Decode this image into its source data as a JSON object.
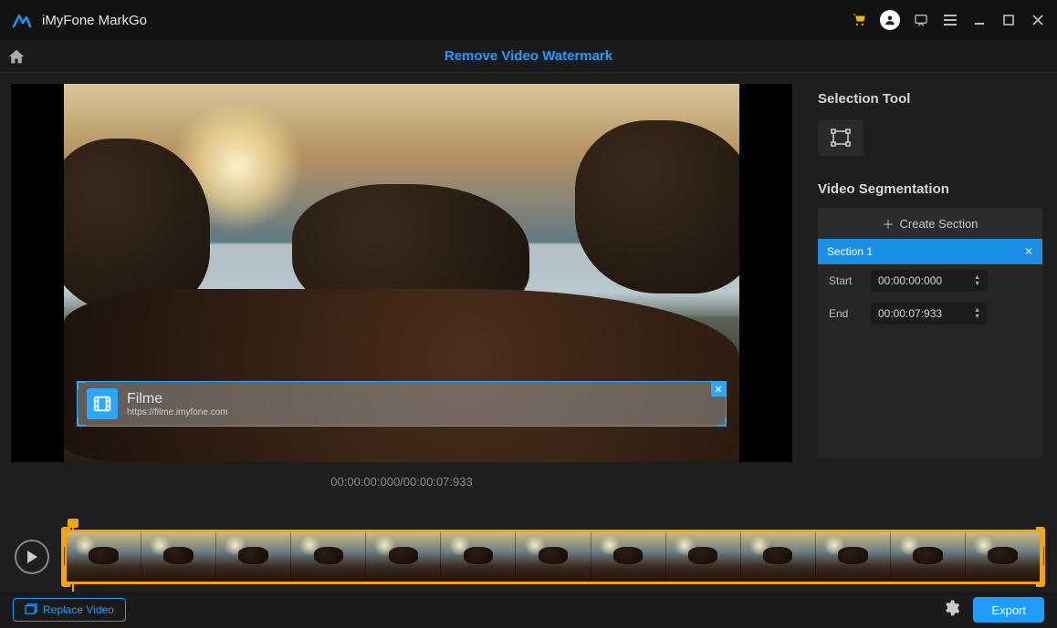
{
  "titlebar": {
    "app_name": "iMyFone MarkGo"
  },
  "toolbar": {
    "title": "Remove Video Watermark"
  },
  "preview": {
    "timecode_current": "00:00:00:000",
    "timecode_total": "00:00:07:933",
    "timecode_display": "00:00:00:000/00:00:07:933",
    "watermark": {
      "title": "Filme",
      "subtitle": "https://filme.imyfone.com"
    }
  },
  "sidepanel": {
    "selection_tool_label": "Selection Tool",
    "segmentation_label": "Video Segmentation",
    "create_section_label": "Create Section",
    "section_name": "Section 1",
    "start_label": "Start",
    "start_value": "00:00:00:000",
    "end_label": "End",
    "end_value": "00:00:07:933"
  },
  "footer": {
    "replace_label": "Replace Video",
    "export_label": "Export"
  },
  "colors": {
    "accent_blue": "#1e9dff",
    "accent_orange": "#f5a400"
  }
}
